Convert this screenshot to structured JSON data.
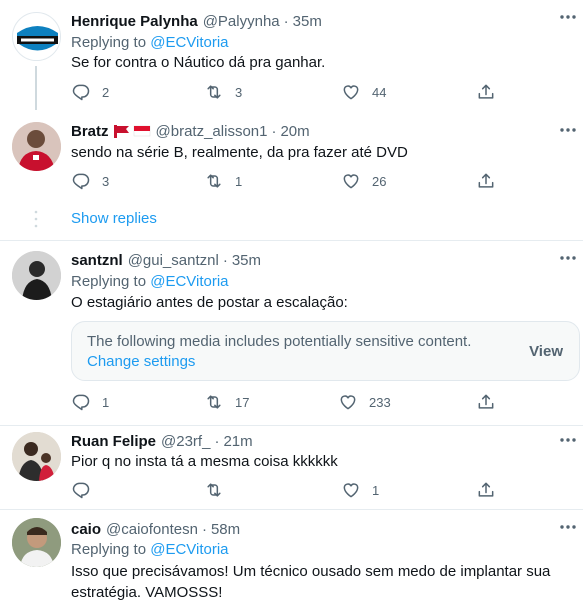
{
  "tweets": [
    {
      "name": "Henrique Palynha",
      "handle": "@Palyynha",
      "time": "35m",
      "replying_label": "Replying to",
      "replying_to": "@ECVitoria",
      "text": "Se for contra o Náutico dá pra ganhar.",
      "replies": "2",
      "retweets": "3",
      "likes": "44"
    },
    {
      "name": "Bratz",
      "handle": "@bratz_alisson1",
      "time": "20m",
      "text": "sendo na série B, realmente, da pra fazer até DVD",
      "replies": "3",
      "retweets": "1",
      "likes": "26"
    },
    {
      "name": "santznl",
      "handle": "@gui_santznl",
      "time": "35m",
      "replying_label": "Replying to",
      "replying_to": "@ECVitoria",
      "text": "O estagiário antes de postar a escalação:",
      "replies": "1",
      "retweets": "17",
      "likes": "233"
    },
    {
      "name": "Ruan Felipe",
      "handle": "@23rf_",
      "time": "21m",
      "text": "Pior q no insta tá a mesma coisa kkkkkk",
      "replies": "",
      "retweets": "",
      "likes": "1"
    },
    {
      "name": "caio",
      "handle": "@caiofontesn",
      "time": "58m",
      "replying_label": "Replying to",
      "replying_to": "@ECVitoria",
      "text": "Isso que precisávamos! Um técnico ousado sem medo de implantar sua estratégia. VAMOSSS!"
    }
  ],
  "show_replies": "Show replies",
  "sensitive_media": {
    "notice": "The following media includes potentially sensitive content.",
    "change_settings": "Change settings",
    "view": "View"
  },
  "separator": "·",
  "colors": {
    "accent": "#1d9bf0",
    "secondary_text": "#536471",
    "divider": "#e6ecf0"
  },
  "icons": [
    "reply-icon",
    "retweet-icon",
    "like-icon",
    "share-icon",
    "more-icon"
  ]
}
